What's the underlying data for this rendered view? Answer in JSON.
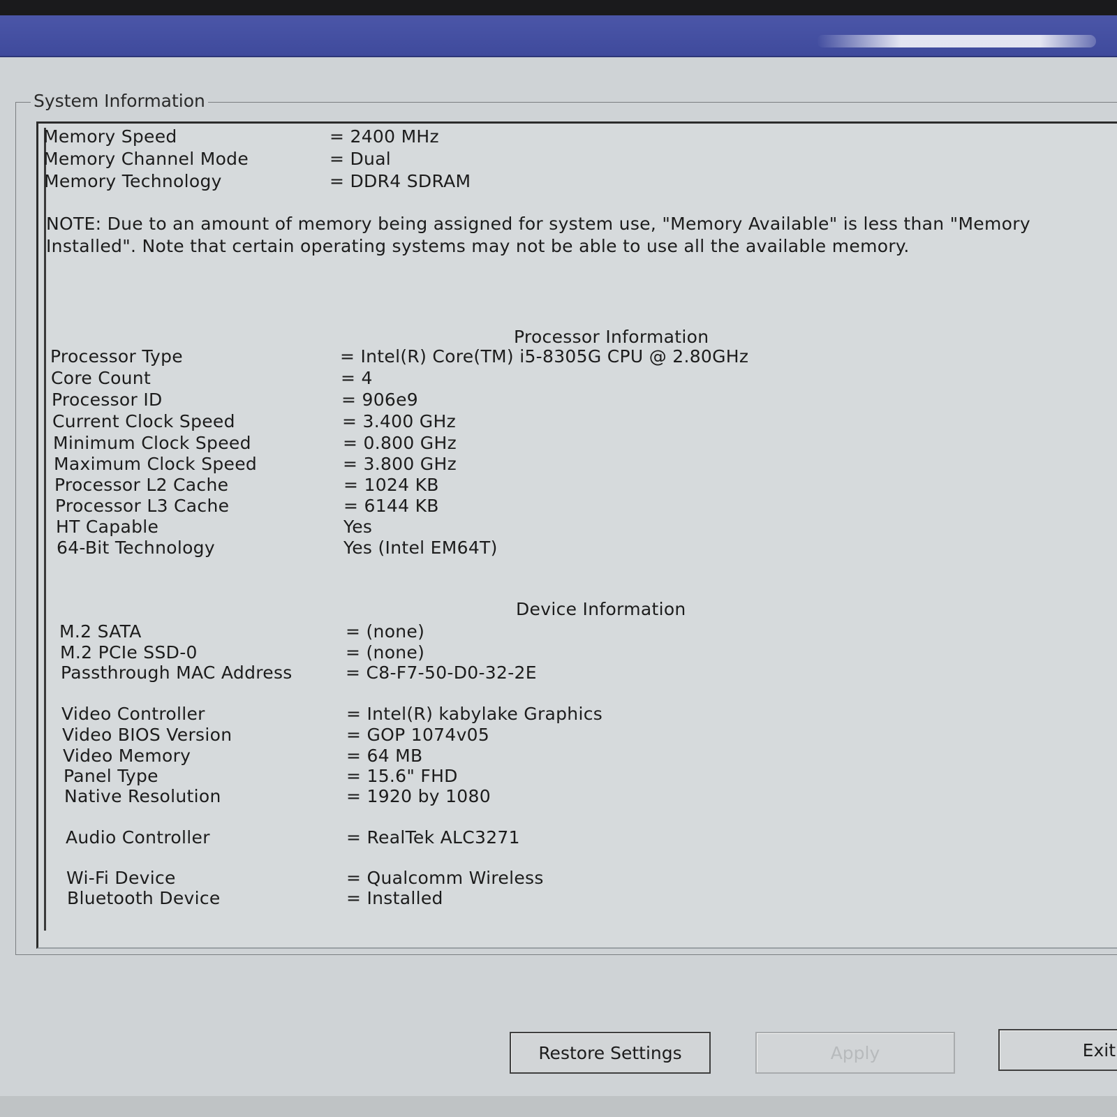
{
  "group_title": "System Information",
  "memory": [
    {
      "label": "Memory Speed",
      "value": "= 2400 MHz"
    },
    {
      "label": "Memory Channel Mode",
      "value": "= Dual"
    },
    {
      "label": "Memory Technology",
      "value": "= DDR4 SDRAM"
    }
  ],
  "note": "NOTE: Due to an amount of memory being assigned for system use, \"Memory Available\" is less than \"Memory Installed\". Note that certain operating systems may not be able to use all the available memory.",
  "processor": {
    "title": "Processor Information",
    "rows": [
      {
        "label": "Processor Type",
        "value": "= Intel(R) Core(TM) i5-8305G CPU @ 2.80GHz"
      },
      {
        "label": "Core Count",
        "value": "= 4"
      },
      {
        "label": "Processor ID",
        "value": "= 906e9"
      },
      {
        "label": "Current Clock Speed",
        "value": "= 3.400 GHz"
      },
      {
        "label": "Minimum Clock Speed",
        "value": "= 0.800 GHz"
      },
      {
        "label": "Maximum Clock Speed",
        "value": "= 3.800 GHz"
      },
      {
        "label": "Processor L2 Cache",
        "value": "= 1024 KB"
      },
      {
        "label": "Processor L3 Cache",
        "value": "= 6144 KB"
      },
      {
        "label": "HT Capable",
        "value": "Yes"
      },
      {
        "label": "64-Bit Technology",
        "value": "Yes (Intel EM64T)"
      }
    ]
  },
  "device": {
    "title": "Device Information",
    "rows": [
      {
        "label": "M.2 SATA",
        "value": "= (none)"
      },
      {
        "label": "M.2 PCIe SSD-0",
        "value": "= (none)"
      },
      {
        "label": "Passthrough MAC Address",
        "value": "= C8-F7-50-D0-32-2E"
      },
      {
        "label": "Video Controller",
        "value": "= Intel(R) kabylake Graphics"
      },
      {
        "label": "Video BIOS Version",
        "value": "= GOP 1074v05"
      },
      {
        "label": "Video Memory",
        "value": "= 64 MB"
      },
      {
        "label": "Panel Type",
        "value": "= 15.6\" FHD"
      },
      {
        "label": "Native Resolution",
        "value": "= 1920 by 1080"
      },
      {
        "label": "Audio Controller",
        "value": "= RealTek ALC3271"
      },
      {
        "label": "Wi-Fi Device",
        "value": "= Qualcomm Wireless"
      },
      {
        "label": "Bluetooth Device",
        "value": "= Installed"
      }
    ]
  },
  "buttons": {
    "restore": "Restore Settings",
    "apply": "Apply",
    "exit": "Exit"
  }
}
